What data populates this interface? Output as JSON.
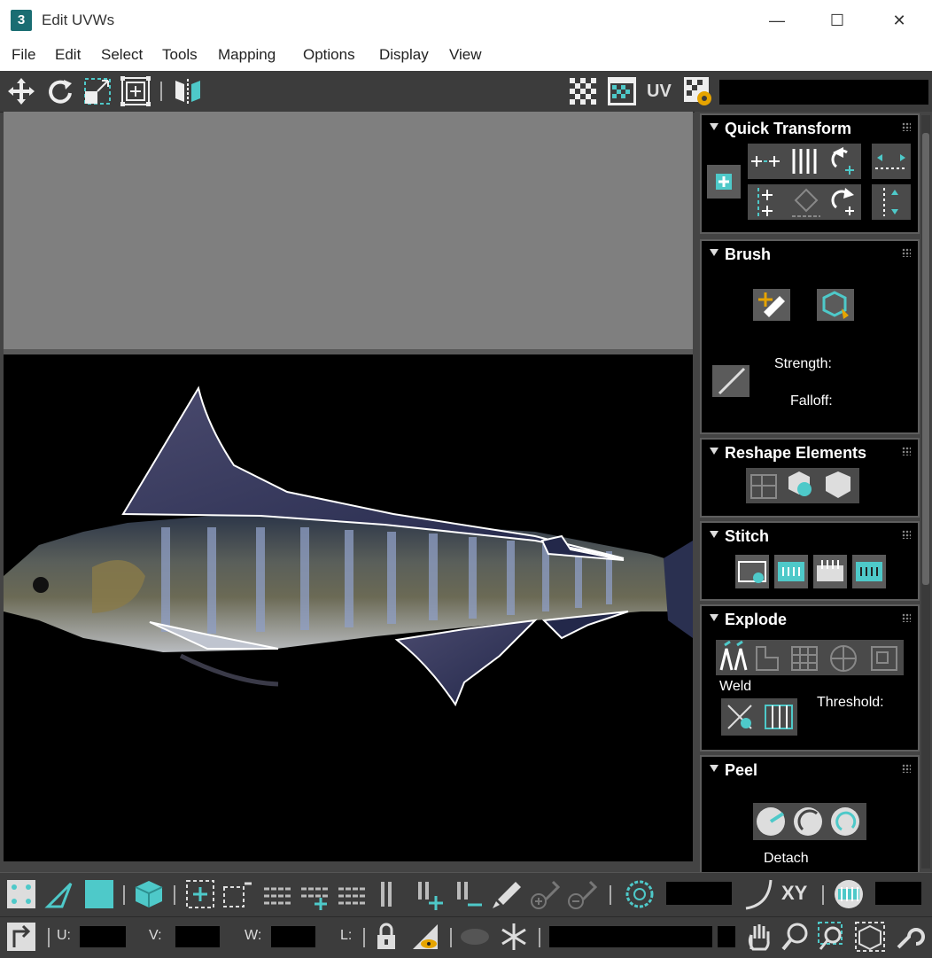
{
  "window": {
    "app_icon": "3",
    "title": "Edit UVWs",
    "minimize": "—",
    "maximize": "☐",
    "close": "✕"
  },
  "menu": [
    "File",
    "Edit",
    "Select",
    "Tools",
    "Mapping",
    "Options",
    "Display",
    "View"
  ],
  "toolbar": {
    "uv_label": "UV"
  },
  "panels": {
    "quick_transform": {
      "title": "Quick Transform"
    },
    "brush": {
      "title": "Brush",
      "strength_label": "Strength:",
      "falloff_label": "Falloff:"
    },
    "reshape": {
      "title": "Reshape Elements"
    },
    "stitch": {
      "title": "Stitch"
    },
    "explode": {
      "title": "Explode",
      "weld_label": "Weld",
      "threshold_label": "Threshold:"
    },
    "peel": {
      "title": "Peel",
      "detach_label": "Detach"
    }
  },
  "bottom_toolbar": {
    "xy_label": "XY"
  },
  "status": {
    "u_label": "U:",
    "v_label": "V:",
    "w_label": "W:",
    "l_label": "L:"
  },
  "colors": {
    "accent": "#4ec9c9",
    "panel_bg": "#444444",
    "viewport_bg": "#000000",
    "grid_gray": "#7f7f7f"
  }
}
